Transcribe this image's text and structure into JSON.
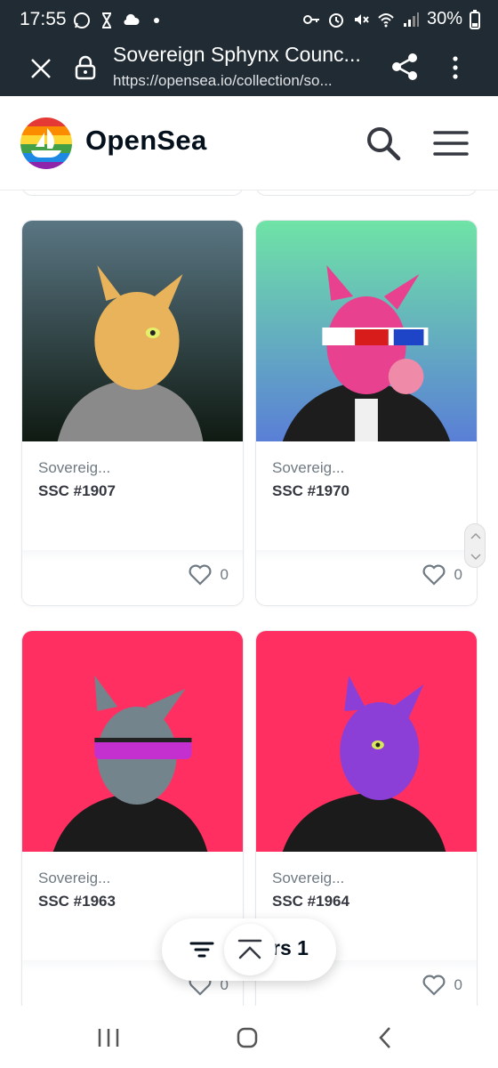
{
  "status_bar": {
    "time": "17:55",
    "battery": "30%",
    "icons_left": [
      "whatsapp-icon",
      "hourglass-icon",
      "cloud-icon",
      "dot-icon"
    ],
    "icons_right": [
      "key-icon",
      "alarm-icon",
      "mute-icon",
      "wifi-icon",
      "signal-icon",
      "battery-icon"
    ]
  },
  "browser": {
    "title": "Sovereign Sphynx Counc...",
    "url": "https://opensea.io/collection/so..."
  },
  "header": {
    "brand": "OpenSea"
  },
  "cards": [
    {
      "collection": "Sovereig...",
      "name": "SSC #1907",
      "likes": "0",
      "bg_top": "#5a7683",
      "bg_bottom": "#0f1a12",
      "skin": "#e8b35a",
      "clothing": "#8a8a8a"
    },
    {
      "collection": "Sovereig...",
      "name": "SSC #1970",
      "likes": "0",
      "bg_top": "#6fe3a6",
      "bg_bottom": "#5a7fd6",
      "skin": "#e8418f",
      "clothing": "#1d1d1d"
    },
    {
      "collection": "Sovereig...",
      "name": "SSC #1963",
      "likes": "0",
      "bg_top": "#ff3061",
      "bg_bottom": "#ff3061",
      "skin": "#74848c",
      "clothing": "#1b1b1b"
    },
    {
      "collection": "Sovereig...",
      "name": "SSC #1964",
      "likes": "0",
      "bg_top": "#ff3061",
      "bg_bottom": "#ff3061",
      "skin": "#8b3fd6",
      "clothing": "#1b1b1b"
    }
  ],
  "floating_bar": {
    "filters_label": "rs 1"
  },
  "colors": {
    "chrome": "#202b33",
    "brand_text": "#04111d"
  }
}
